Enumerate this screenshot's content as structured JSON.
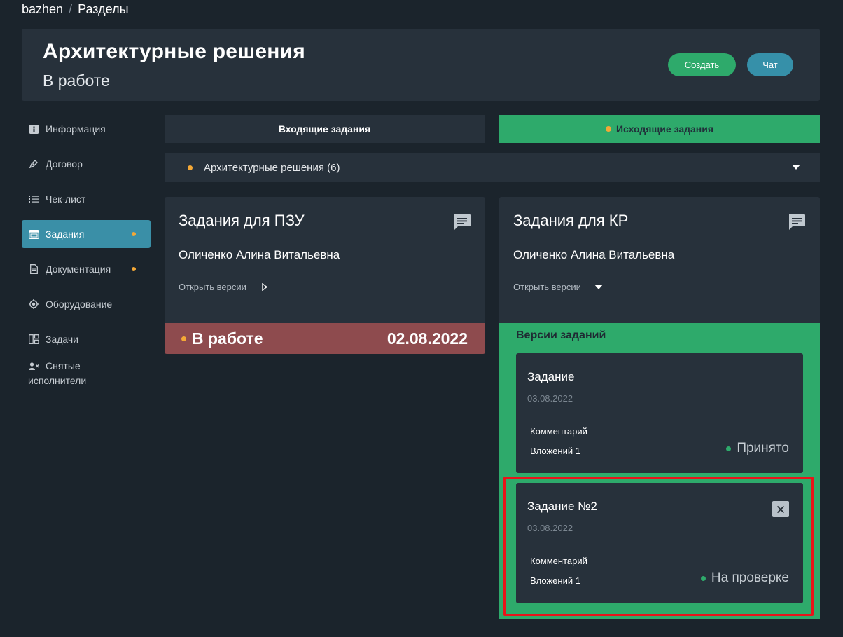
{
  "breadcrumb": {
    "root": "bazhen",
    "separator": "/",
    "current": "Разделы"
  },
  "header": {
    "title": "Архитектурные решения",
    "status": "В работе",
    "create_label": "Создать",
    "chat_label": "Чат"
  },
  "sidebar": {
    "items": [
      {
        "label": "Информация",
        "icon": "info-icon"
      },
      {
        "label": "Договор",
        "icon": "pen-icon"
      },
      {
        "label": "Чек-лист",
        "icon": "checklist-icon"
      },
      {
        "label": "Задания",
        "icon": "window-icon",
        "active": true,
        "has_dot": true
      },
      {
        "label": "Документация",
        "icon": "document-icon",
        "has_dot": true
      },
      {
        "label": "Оборудование",
        "icon": "chip-icon"
      },
      {
        "label": "Задачи",
        "icon": "board-icon"
      },
      {
        "label_line1": "Снятые",
        "label_line2": "исполнители",
        "icon": "user-remove-icon"
      }
    ]
  },
  "tabs": {
    "incoming": "Входящие задания",
    "outgoing": "Исходящие задания"
  },
  "section_select": {
    "value": "Архитектурные решения (6)"
  },
  "cards": [
    {
      "title": "Задания для ПЗУ",
      "person": "Оличенко Алина Витальевна",
      "open_versions": "Открыть версии",
      "status": "В работе",
      "date": "02.08.2022"
    },
    {
      "title": "Задания для КР",
      "person": "Оличенко Алина Витальевна",
      "open_versions": "Открыть версии"
    }
  ],
  "versions": {
    "title": "Версии заданий",
    "items": [
      {
        "name": "Задание",
        "date": "03.08.2022",
        "comment": "Комментарий",
        "attachments": "Вложений 1",
        "status": "Принято"
      },
      {
        "name": "Задание №2",
        "date": "03.08.2022",
        "comment": "Комментарий",
        "attachments": "Вложений 1",
        "status": "На проверке"
      }
    ]
  },
  "colors": {
    "accent_green": "#2eaa6b",
    "accent_blue": "#3a8fa7",
    "status_red": "#8e4b4e",
    "dot_orange": "#f4a836",
    "highlight_red": "#e8141a"
  }
}
